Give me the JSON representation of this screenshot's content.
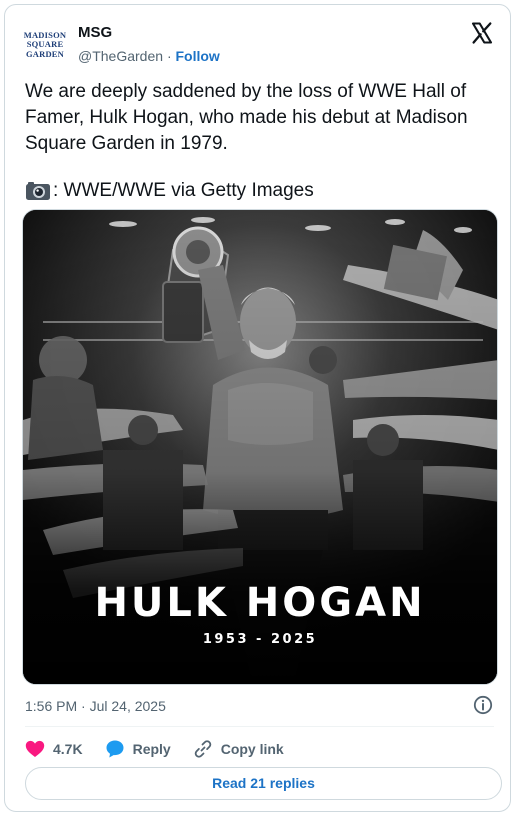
{
  "account": {
    "avatar_lines": [
      "MADISON",
      "SQUARE",
      "GARDEN"
    ],
    "name": "MSG",
    "handle": "@TheGarden",
    "separator": "·",
    "follow_label": "Follow"
  },
  "tweet": {
    "text": "We are deeply saddened by the loss of WWE Hall of Famer, Hulk Hogan, who made his debut at Madison Square Garden in 1979.",
    "credit_icon": "camera-icon",
    "credit_text": ": WWE/WWE via Getty Images"
  },
  "media": {
    "title": "HULK HOGAN",
    "years": "1953 - 2025"
  },
  "meta": {
    "timestamp": "1:56 PM · Jul 24, 2025"
  },
  "actions": {
    "like_count": "4.7K",
    "reply_label": "Reply",
    "copy_label": "Copy link"
  },
  "footer": {
    "read_replies_label": "Read 21 replies"
  },
  "colors": {
    "like": "#f91880",
    "reply": "#1d9bf0",
    "link": "#1d73c6",
    "muted": "#536471"
  }
}
